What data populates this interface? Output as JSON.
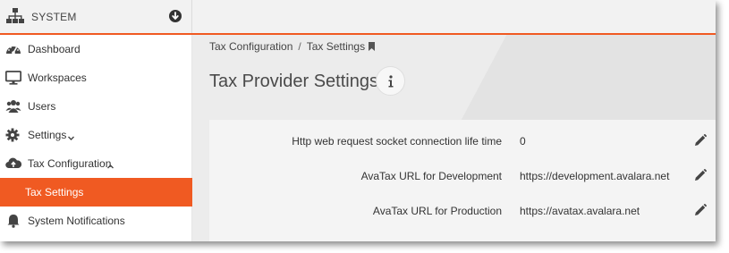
{
  "topbar": {
    "system_label": "SYSTEM",
    "system_icon": "sitemap-icon",
    "dropdown_icon": "arrow-down-circle-icon"
  },
  "sidebar": {
    "items": [
      {
        "label": "Dashboard",
        "icon": "dashboard-icon"
      },
      {
        "label": "Workspaces",
        "icon": "monitor-icon"
      },
      {
        "label": "Users",
        "icon": "users-icon"
      },
      {
        "label": "Settings",
        "icon": "gear-icon",
        "expander": "chevron-down"
      },
      {
        "label": "Tax Configuration",
        "icon": "cloud-upload-icon",
        "expander": "chevron-up"
      },
      {
        "label": "Tax Settings",
        "active": true
      },
      {
        "label": "System Notifications",
        "icon": "bell-icon"
      }
    ]
  },
  "breadcrumb": {
    "parent": "Tax Configuration",
    "separator": "/",
    "current": "Tax Settings",
    "bookmark_icon": "bookmark-icon"
  },
  "page": {
    "title": "Tax Provider Settings",
    "info_icon": "info-icon"
  },
  "settings": [
    {
      "label": "Http web request socket connection life time",
      "value": "0"
    },
    {
      "label": "AvaTax URL for Development",
      "value": "https://development.avalara.net"
    },
    {
      "label": "AvaTax URL for Production",
      "value": "https://avatax.avalara.net"
    }
  ],
  "colors": {
    "accent": "#f05a22",
    "topbar_bg": "#f2f2f2",
    "main_bg": "#ececec",
    "panel_bg": "#f4f4f4"
  }
}
